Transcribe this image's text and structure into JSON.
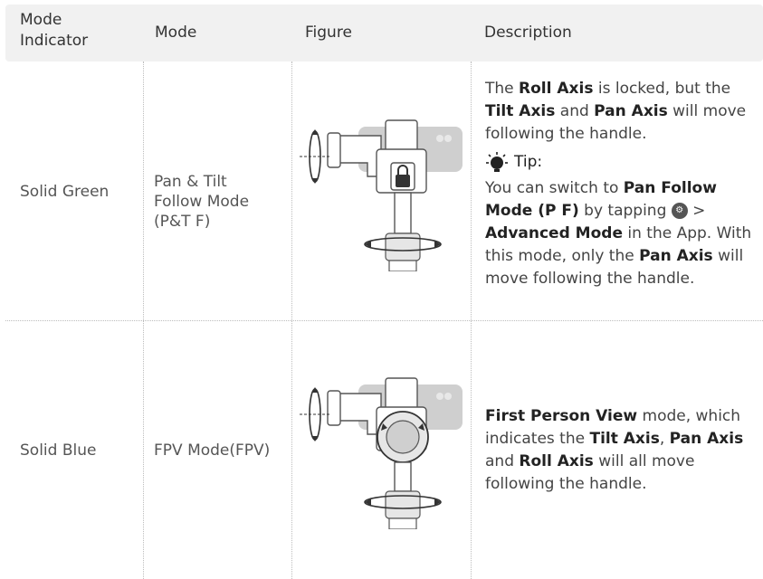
{
  "header": {
    "col1": "Mode\nIndicator",
    "col2": "Mode",
    "col3": "Figure",
    "col4": "Description"
  },
  "rows": [
    {
      "indicator": "Solid Green",
      "mode": "Pan & Tilt\nFollow Mode\n(P&T F)",
      "desc": {
        "p1_a": "The ",
        "p1_b": "Roll Axis",
        "p1_c": " is locked, but the ",
        "p1_d": "Tilt Axis",
        "p1_e": " and ",
        "p1_f": "Pan Axis",
        "p1_g": " will move following the handle.",
        "tip_label": "Tip:",
        "p2_a": "You can switch to ",
        "p2_b": "Pan Follow Mode (P F)",
        "p2_c": " by tapping ",
        "p2_d": " > ",
        "p2_e": "Advanced Mode",
        "p2_f": " in the App. With this mode, only the ",
        "p2_g": "Pan Axis",
        "p2_h": " will move following the handle."
      }
    },
    {
      "indicator": "Solid Blue",
      "mode": "FPV Mode(FPV)",
      "desc": {
        "a": "First Person View",
        "b": " mode, which indicates the ",
        "c": "Tilt Axis",
        "d": ", ",
        "e": "Pan Axis",
        "f": " and ",
        "g": "Roll Axis",
        "h": " will all move following the handle."
      }
    }
  ],
  "icons": {
    "tip": "lightbulb-icon",
    "app_settings": "gimbal-settings-icon",
    "lock": "lock-icon"
  },
  "colors": {
    "header_bg": "#f1f1f1",
    "text": "#555555",
    "bold": "#222222"
  }
}
